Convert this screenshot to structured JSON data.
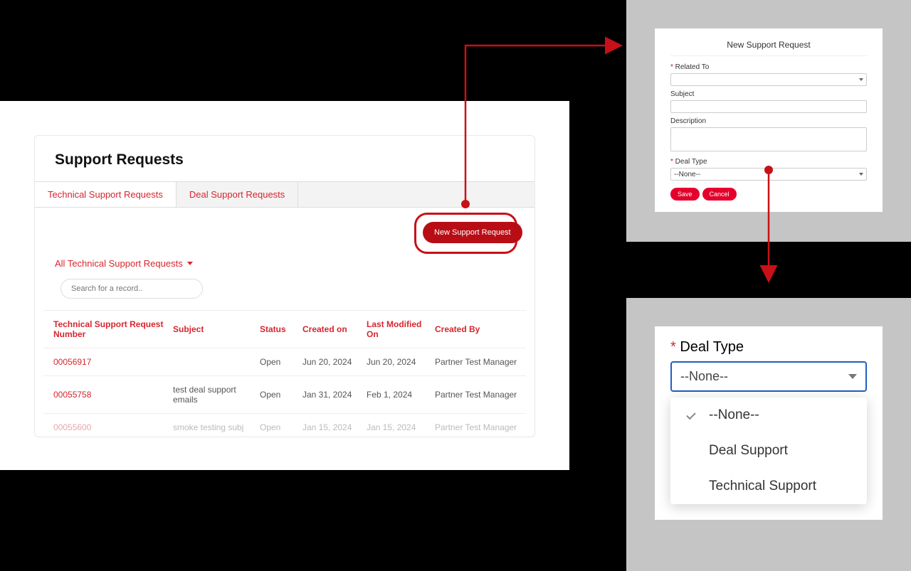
{
  "panel1": {
    "title": "Support Requests",
    "tabs": [
      "Technical Support Requests",
      "Deal Support Requests"
    ],
    "new_button": "New Support Request",
    "filter_label": "All Technical Support Requests",
    "search_placeholder": "Search for a record..",
    "columns": [
      "Technical Support Request Number",
      "Subject",
      "Status",
      "Created on",
      "Last Modified On",
      "Created By"
    ],
    "rows": [
      {
        "number": "00056917",
        "subject": "",
        "status": "Open",
        "created": "Jun 20, 2024",
        "modified": "Jun 20, 2024",
        "by": "Partner Test Manager",
        "faded": false
      },
      {
        "number": "00055758",
        "subject": "test deal support emails",
        "status": "Open",
        "created": "Jan 31, 2024",
        "modified": "Feb 1, 2024",
        "by": "Partner Test Manager",
        "faded": false
      },
      {
        "number": "00055600",
        "subject": "smoke testing subj",
        "status": "Open",
        "created": "Jan 15, 2024",
        "modified": "Jan 15, 2024",
        "by": "Partner Test Manager",
        "faded": true
      }
    ]
  },
  "panel2": {
    "title": "New Support Request",
    "related_to_label": "Related To",
    "subject_label": "Subject",
    "description_label": "Description",
    "deal_type_label": "Deal Type",
    "deal_type_value": "--None--",
    "save": "Save",
    "cancel": "Cancel"
  },
  "panel3": {
    "label": "Deal Type",
    "selected": "--None--",
    "options": [
      "--None--",
      "Deal Support",
      "Technical Support"
    ]
  }
}
